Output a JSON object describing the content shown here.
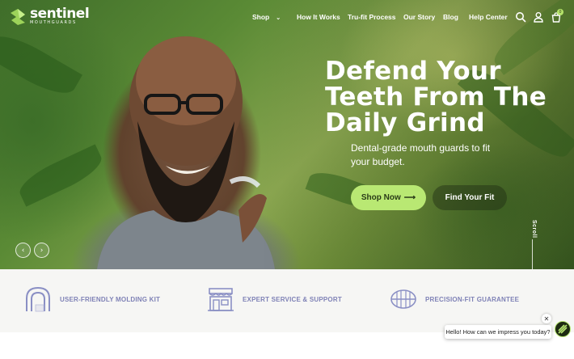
{
  "brand": {
    "name": "sentinel",
    "tagline": "MOUTHGUARDS",
    "accent": "#b9e873",
    "feature_text_color": "#7f82b6"
  },
  "nav": {
    "items": [
      {
        "label": "Shop",
        "has_dropdown": true
      },
      {
        "label": "How It Works"
      },
      {
        "label": "Tru-fit Process"
      },
      {
        "label": "Our Story"
      },
      {
        "label": "Blog"
      },
      {
        "label": "Help Center"
      }
    ],
    "icons": [
      "search-icon",
      "account-icon",
      "cart-icon"
    ],
    "cart_count": "0"
  },
  "hero": {
    "headline": "Defend Your Teeth From The Daily Grind",
    "subhead": "Dental-grade mouth guards to fit your budget.",
    "primary_cta": "Shop Now",
    "primary_cta_arrow": "⟶",
    "secondary_cta": "Find Your Fit",
    "scroll_label": "Scroll",
    "prev_glyph": "‹",
    "next_glyph": "›"
  },
  "features": [
    {
      "label": "USER-FRIENDLY MOLDING KIT",
      "icon": "mouthguard-icon"
    },
    {
      "label": "EXPERT SERVICE & SUPPORT",
      "icon": "storefront-icon"
    },
    {
      "label": "PRECISION-FIT GUARANTEE",
      "icon": "teeth-icon"
    }
  ],
  "chat": {
    "message": "Hello! How can we impress you today?",
    "close_glyph": "✕"
  }
}
